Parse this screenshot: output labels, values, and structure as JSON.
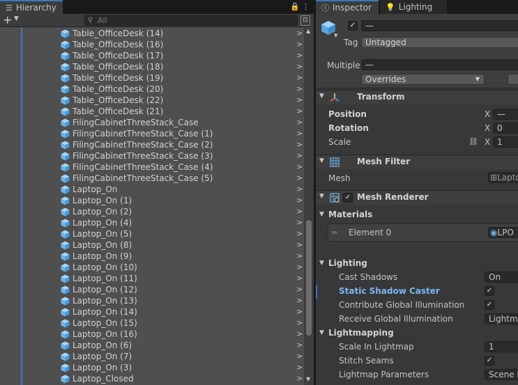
{
  "hierarchy": {
    "tab_label": "Hierarchy",
    "search_placeholder": "All",
    "add_label": "+",
    "items": [
      "Table_OfficeDesk (14)",
      "Table_OfficeDesk (16)",
      "Table_OfficeDesk (17)",
      "Table_OfficeDesk (18)",
      "Table_OfficeDesk (19)",
      "Table_OfficeDesk (20)",
      "Table_OfficeDesk (22)",
      "Table_OfficeDesk (21)",
      "FilingCabinetThreeStack_Case",
      "FilingCabinetThreeStack_Case (1)",
      "FilingCabinetThreeStack_Case (2)",
      "FilingCabinetThreeStack_Case (3)",
      "FilingCabinetThreeStack_Case (4)",
      "FilingCabinetThreeStack_Case (5)",
      "Laptop_On",
      "Laptop_On (1)",
      "Laptop_On (2)",
      "Laptop_On (4)",
      "Laptop_On (5)",
      "Laptop_On (8)",
      "Laptop_On (9)",
      "Laptop_On (10)",
      "Laptop_On (11)",
      "Laptop_On (12)",
      "Laptop_On (13)",
      "Laptop_On (14)",
      "Laptop_On (15)",
      "Laptop_On (16)",
      "Laptop_On (6)",
      "Laptop_On (7)",
      "Laptop_On (3)",
      "Laptop_Closed"
    ]
  },
  "inspector": {
    "tab_label": "Inspector",
    "lighting_tab_label": "Lighting",
    "name_value": "—",
    "tag_label": "Tag",
    "tag_value": "Untagged",
    "multiple_label": "Multiple",
    "multiple_value": "—",
    "overrides_label": "Overrides",
    "transform": {
      "title": "Transform",
      "position_label": "Position",
      "rotation_label": "Rotation",
      "scale_label": "Scale",
      "x_label": "X",
      "position_x": "—",
      "rotation_x": "0",
      "scale_x": "1"
    },
    "mesh_filter": {
      "title": "Mesh Filter",
      "mesh_label": "Mesh",
      "mesh_value": "Lapto"
    },
    "mesh_renderer": {
      "title": "Mesh Renderer",
      "materials_label": "Materials",
      "element_label": "Element 0",
      "element_value": "LPO",
      "lighting_label": "Lighting",
      "cast_shadows_label": "Cast Shadows",
      "cast_shadows_value": "On",
      "static_shadow_label": "Static Shadow Caster",
      "contribute_gi_label": "Contribute Global Illumination",
      "receive_gi_label": "Receive Global Illumination",
      "receive_gi_value": "Lightma",
      "lightmapping_label": "Lightmapping",
      "scale_lightmap_label": "Scale In Lightmap",
      "scale_lightmap_value": "1",
      "stitch_seams_label": "Stitch Seams",
      "lightmap_params_label": "Lightmap Parameters",
      "lightmap_params_value": "Scene D"
    }
  },
  "colors": {
    "accent": "#3a79bb",
    "cube": "#6cb4ec",
    "highlight_label": "#7cb7f2"
  }
}
